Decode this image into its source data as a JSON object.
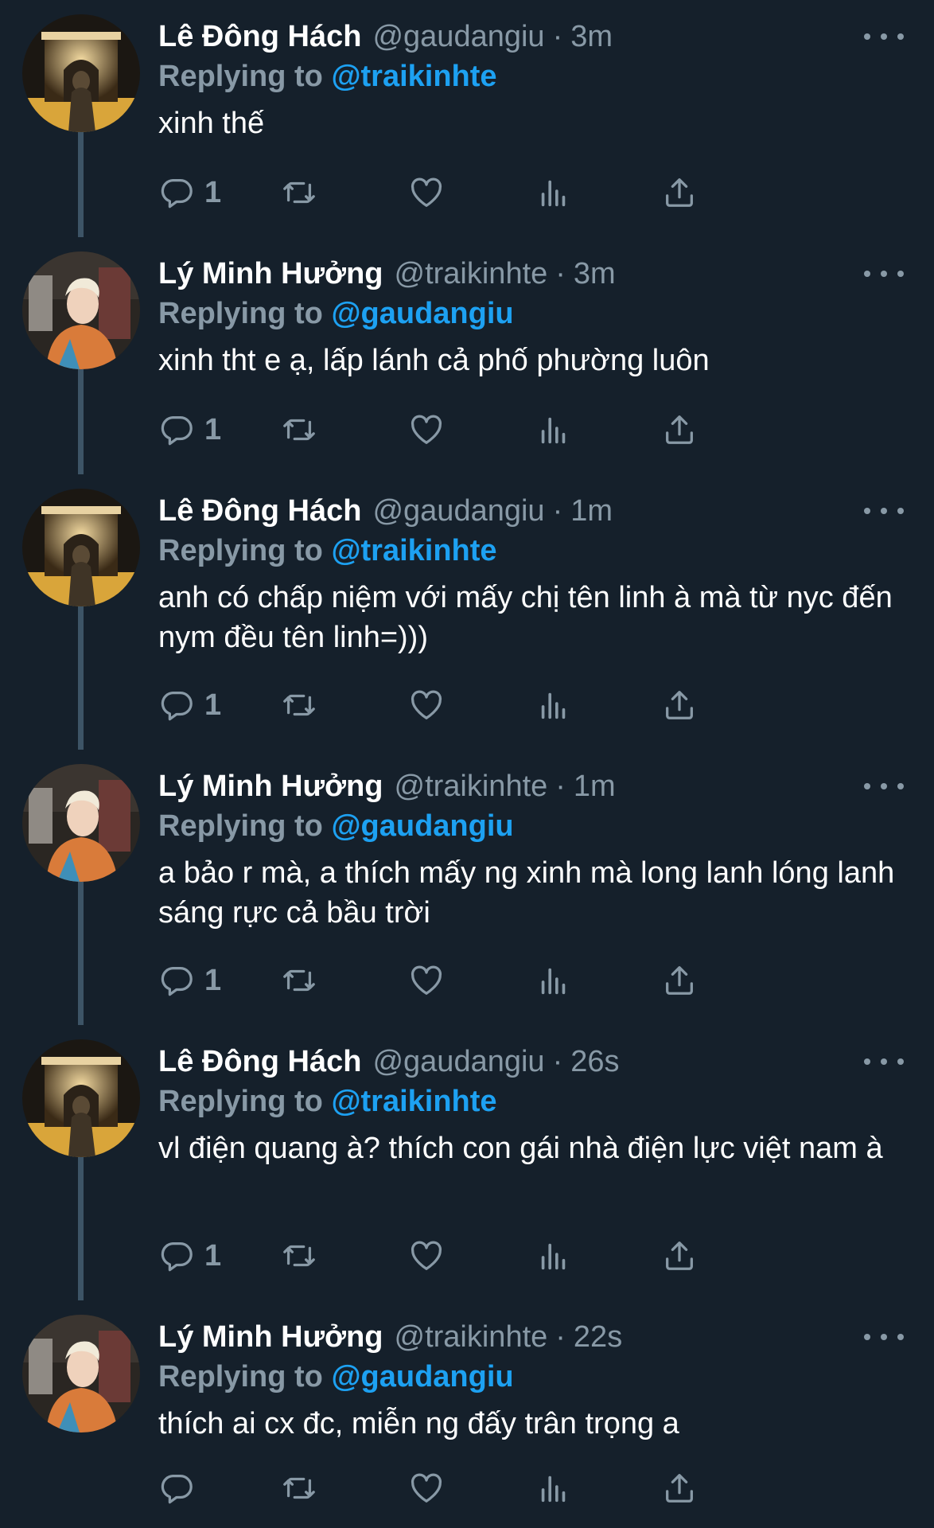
{
  "reply_label": "Replying to",
  "tweets": [
    {
      "name": "Lê Đông Hách",
      "handle": "@gaudangiu",
      "separator": "·",
      "time": "3m",
      "replying_to": "@traikinhte",
      "text": "xinh thế",
      "reply_count": "1",
      "avatar": "arc-de-triomphe-photo"
    },
    {
      "name": "Lý Minh Hưởng",
      "handle": "@traikinhte",
      "separator": "·",
      "time": "3m",
      "replying_to": "@gaudangiu",
      "text": "xinh tht e ạ, lấp lánh cả phố phường luôn",
      "reply_count": "1",
      "avatar": "man-portrait-photo"
    },
    {
      "name": "Lê Đông Hách",
      "handle": "@gaudangiu",
      "separator": "·",
      "time": "1m",
      "replying_to": "@traikinhte",
      "text": "anh có chấp niệm với mấy chị tên linh à mà từ nyc đến nym đều tên linh=)))",
      "reply_count": "1",
      "avatar": "arc-de-triomphe-photo"
    },
    {
      "name": "Lý Minh Hưởng",
      "handle": "@traikinhte",
      "separator": "·",
      "time": "1m",
      "replying_to": "@gaudangiu",
      "text": "a bảo r mà, a thích mấy ng xinh mà long lanh lóng lanh sáng rực cả bầu trời",
      "reply_count": "1",
      "avatar": "man-portrait-photo"
    },
    {
      "name": "Lê Đông Hách",
      "handle": "@gaudangiu",
      "separator": "·",
      "time": "26s",
      "replying_to": "@traikinhte",
      "text": "vl điện quang à? thích con gái nhà điện lực việt nam à",
      "reply_count": "1",
      "avatar": "arc-de-triomphe-photo"
    },
    {
      "name": "Lý Minh Hưởng",
      "handle": "@traikinhte",
      "separator": "·",
      "time": "22s",
      "replying_to": "@gaudangiu",
      "text": "thích ai cx đc, miễn ng đấy trân trọng a",
      "reply_count": "",
      "avatar": "man-portrait-photo"
    }
  ],
  "colors": {
    "background": "#15202b",
    "secondary_text": "#8899a6",
    "accent": "#1da1f2",
    "thread_line": "#3d5466"
  },
  "icons": [
    "reply-icon",
    "retweet-icon",
    "like-icon",
    "analytics-icon",
    "share-icon",
    "more-icon"
  ]
}
